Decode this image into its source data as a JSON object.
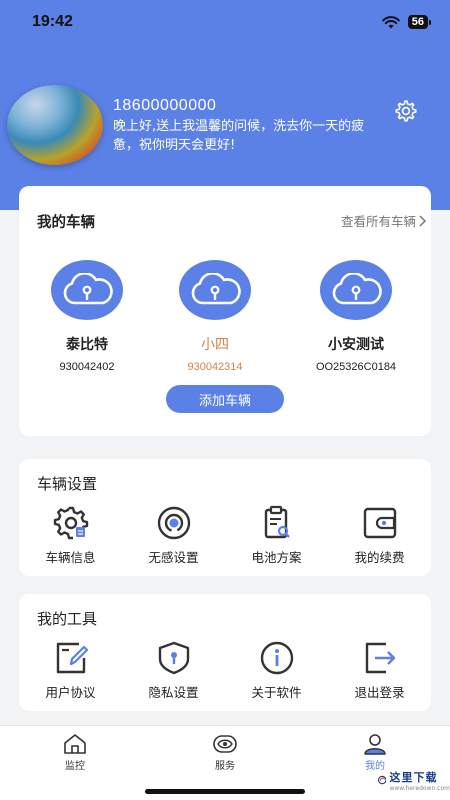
{
  "status_bar": {
    "time": "19:42",
    "battery": "56"
  },
  "profile": {
    "phone": "18600000000",
    "greeting": "晚上好,送上我温馨的问候，洗去你一天的疲惫，祝你明天会更好!"
  },
  "vehicles_card": {
    "title": "我的车辆",
    "view_all": "查看所有车辆",
    "add_button": "添加车辆",
    "vehicles": [
      {
        "name": "泰比特",
        "id": "930042402",
        "active": false
      },
      {
        "name": "小四",
        "id": "930042314",
        "active": true
      },
      {
        "name": "小安测试",
        "id": "OO25326C0184",
        "active": false
      }
    ]
  },
  "settings_card": {
    "title": "车辆设置",
    "items": [
      {
        "label": "车辆信息",
        "icon": "vehicle-info-gear-icon"
      },
      {
        "label": "无感设置",
        "icon": "sensorless-icon"
      },
      {
        "label": "电池方案",
        "icon": "battery-plan-clipboard-icon"
      },
      {
        "label": "我的续费",
        "icon": "wallet-icon"
      }
    ]
  },
  "tools_card": {
    "title": "我的工具",
    "items": [
      {
        "label": "用户协议",
        "icon": "edit-document-icon"
      },
      {
        "label": "隐私设置",
        "icon": "privacy-shield-icon"
      },
      {
        "label": "关于软件",
        "icon": "info-icon"
      },
      {
        "label": "退出登录",
        "icon": "logout-icon"
      }
    ]
  },
  "tabbar": {
    "tabs": [
      {
        "label": "监控",
        "icon": "home-icon",
        "active": false
      },
      {
        "label": "服务",
        "icon": "eye-icon",
        "active": false
      },
      {
        "label": "我的",
        "icon": "user-icon",
        "active": true
      }
    ]
  },
  "watermark": {
    "text": "这里下载",
    "url": "www.heredown.com"
  },
  "colors": {
    "accent": "#5b80e6",
    "active_vehicle": "#d0824a",
    "background": "#f2f3f5"
  }
}
